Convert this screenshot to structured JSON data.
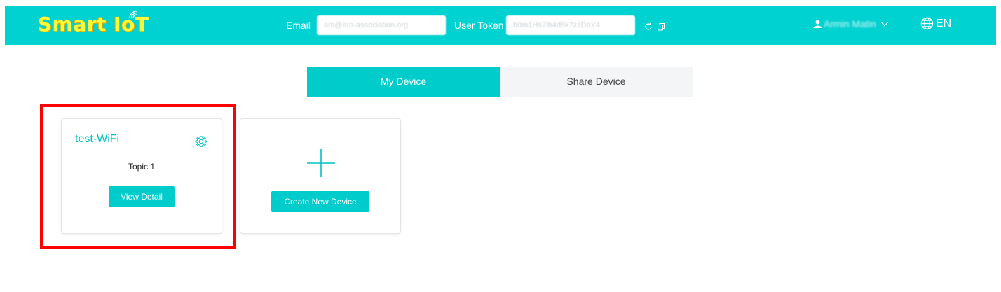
{
  "header": {
    "logo": "Smart IoT",
    "email_label": "Email",
    "email_value": "am@ero-association.org",
    "token_label": "User Token",
    "token_value": "b0m1Hs7lb4d8k7zzDaY4",
    "user_name": "Armin Matin",
    "language": "EN"
  },
  "tabs": [
    {
      "label": "My Device",
      "active": true
    },
    {
      "label": "Share Device",
      "active": false
    }
  ],
  "device_card": {
    "title": "test-WiFi",
    "topic": "Topic:1",
    "button": "View Detail"
  },
  "create_card": {
    "button": "Create New Device"
  },
  "colors": {
    "accent": "#00cccc",
    "header": "#00d1d1",
    "highlight": "#ff0000"
  }
}
